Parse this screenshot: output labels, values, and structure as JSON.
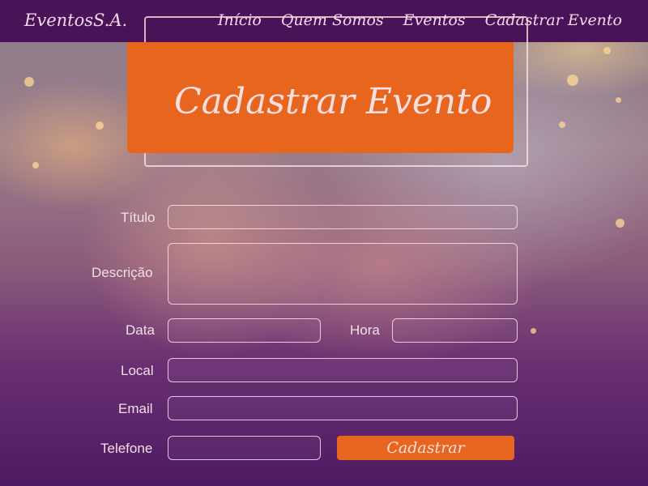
{
  "navbar": {
    "brand": "EventosS.A.",
    "links": [
      "Início",
      "Quem Somos",
      "Eventos",
      "Cadastrar Evento"
    ]
  },
  "hero": {
    "title": "Cadastrar Evento"
  },
  "form": {
    "titulo_label": "Título",
    "descricao_label": "Descrição",
    "data_label": "Data",
    "hora_label": "Hora",
    "local_label": "Local",
    "email_label": "Email",
    "telefone_label": "Telefone",
    "submit_label": "Cadastrar"
  },
  "colors": {
    "navbar": "#4a1257",
    "accent": "#e8651d",
    "text_light": "#f1d9ee"
  }
}
